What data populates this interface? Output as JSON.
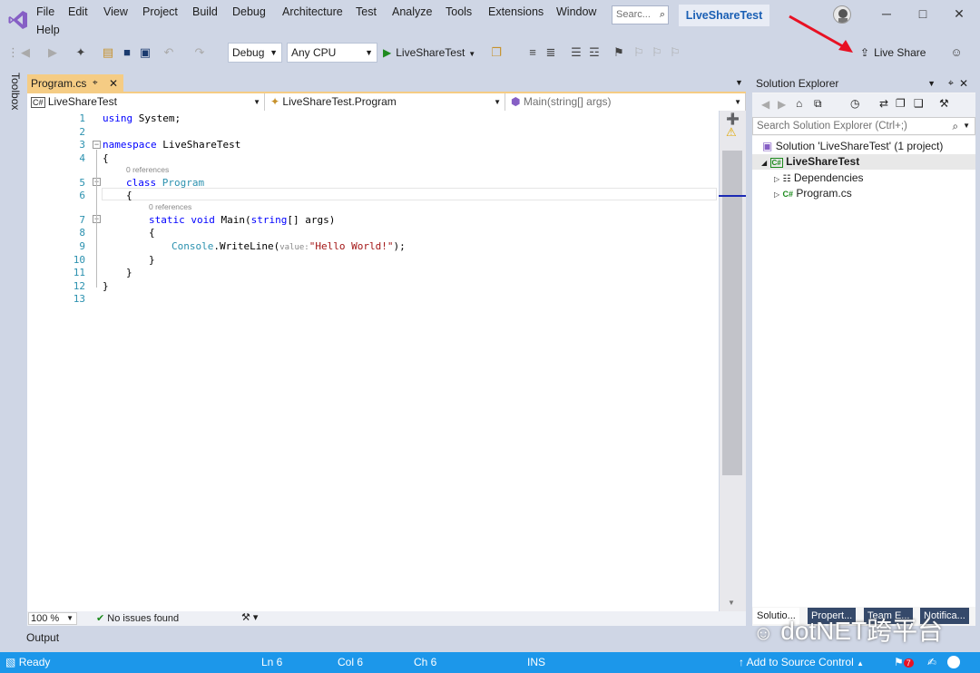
{
  "menu": [
    "File",
    "Edit",
    "View",
    "Project",
    "Build",
    "Debug",
    "Architecture",
    "Test",
    "Analyze",
    "Tools",
    "Extensions",
    "Window",
    "Help"
  ],
  "search": {
    "placeholder": "Searc..."
  },
  "project_title": "LiveShareTest",
  "toolbar": {
    "config": "Debug",
    "platform": "Any CPU",
    "run_label": "LiveShareTest",
    "live_share_label": "Live Share"
  },
  "toolbox_label": "Toolbox",
  "editor": {
    "tab_label": "Program.cs",
    "nav": {
      "project": "LiveShareTest",
      "class": "LiveShareTest.Program",
      "member": "Main(string[] args)"
    },
    "line_numbers": [
      "1",
      "2",
      "3",
      "4",
      "5",
      "6",
      "7",
      "8",
      "9",
      "10",
      "11",
      "12",
      "13"
    ],
    "code": {
      "l1_kw": "using",
      "l1_rest": " System;",
      "l3_kw": "namespace",
      "l3_rest": " LiveShareTest",
      "l4": "{",
      "ref1": "0 references",
      "l5_kw": "class",
      "l5_ty": "Program",
      "l6": "{",
      "ref2": "0 references",
      "l7_kw": "static void",
      "l7_name": "Main",
      "l7_open": "(",
      "l7_kw2": "string",
      "l7_rest": "[] args)",
      "l8": "{",
      "l9_ty": "Console",
      "l9_mid": ".WriteLine(",
      "l9_hint": "value:",
      "l9_str": "\"Hello World!\"",
      "l9_end": ");",
      "l10": "}",
      "l11": "}",
      "l12": "}"
    },
    "zoom": "100 %",
    "issues": "No issues found"
  },
  "output_label": "Output",
  "solution_explorer": {
    "title": "Solution Explorer",
    "search_placeholder": "Search Solution Explorer (Ctrl+;)",
    "solution": "Solution 'LiveShareTest' (1 project)",
    "project": "LiveShareTest",
    "dependencies": "Dependencies",
    "file": "Program.cs",
    "tabs": [
      "Solutio...",
      "Propert...",
      "Team E...",
      "Notifica..."
    ]
  },
  "status": {
    "ready": "Ready",
    "ln": "Ln 6",
    "col": "Col 6",
    "ch": "Ch 6",
    "ins": "INS",
    "source_control": "Add to Source Control",
    "notifications": "7"
  },
  "watermark": "dotNET跨平台",
  "colors": {
    "accent": "#1c97ea",
    "tab_active": "#f5cc84",
    "chrome": "#cfd6e5",
    "arrow": "#e81123"
  }
}
